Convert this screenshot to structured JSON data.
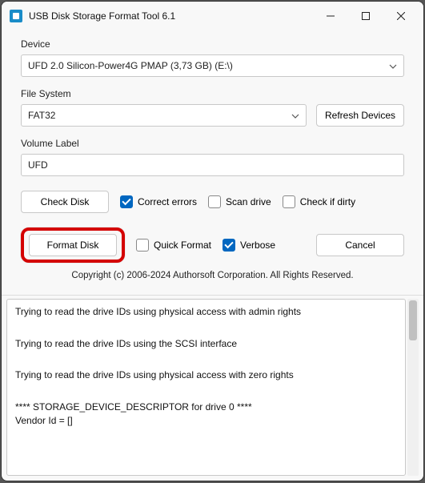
{
  "window": {
    "title": "USB Disk Storage Format Tool 6.1"
  },
  "device": {
    "label": "Device",
    "value": "UFD 2.0  Silicon-Power4G  PMAP (3,73 GB) (E:\\)"
  },
  "filesystem": {
    "label": "File System",
    "value": "FAT32",
    "refresh_label": "Refresh Devices"
  },
  "volume": {
    "label": "Volume Label",
    "value": "UFD"
  },
  "check": {
    "check_disk_label": "Check Disk",
    "correct_errors_label": "Correct errors",
    "scan_drive_label": "Scan drive",
    "check_if_dirty_label": "Check if dirty"
  },
  "format": {
    "format_disk_label": "Format Disk",
    "quick_format_label": "Quick Format",
    "verbose_label": "Verbose",
    "cancel_label": "Cancel"
  },
  "copyright": "Copyright (c) 2006-2024 Authorsoft Corporation. All Rights Reserved.",
  "log": {
    "line1": "Trying to read the drive IDs using physical access with admin rights",
    "line2": "Trying to read the drive IDs using the SCSI interface",
    "line3": "Trying to read the drive IDs using physical access with zero rights",
    "line4": "**** STORAGE_DEVICE_DESCRIPTOR for drive 0 ****",
    "line5": "Vendor Id = []"
  }
}
